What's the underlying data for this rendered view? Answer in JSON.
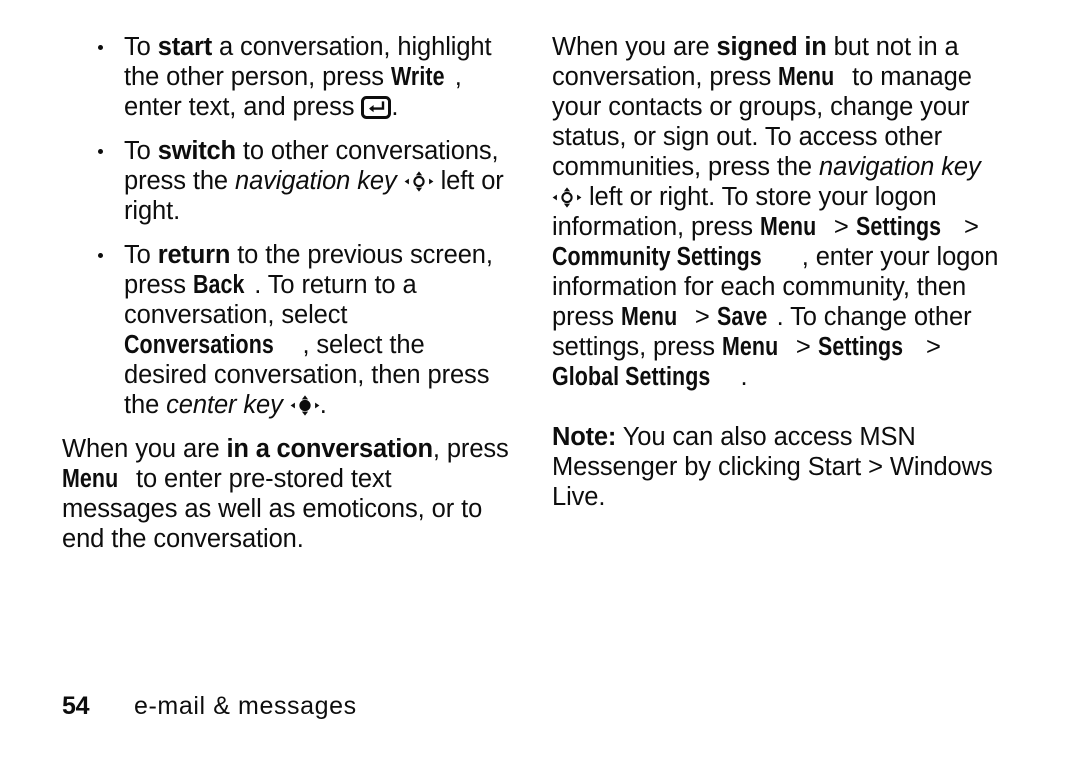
{
  "page": {
    "number": "54",
    "section_title": "e-mail & messages",
    "background_color": "#ffffff",
    "text_color": "#0d0d0d"
  },
  "left_column": {
    "bullets": [
      {
        "id": "start-conversation",
        "segments": [
          {
            "type": "text",
            "value": "To "
          },
          {
            "type": "strong",
            "value": "start"
          },
          {
            "type": "text",
            "value": " a conversation, highlight the other person, press "
          },
          {
            "type": "ui",
            "value": "Write"
          },
          {
            "type": "text",
            "value": ", enter text, and press "
          },
          {
            "type": "icon",
            "value": "enter-key-icon"
          },
          {
            "type": "text",
            "value": "."
          }
        ]
      },
      {
        "id": "switch-conversation",
        "segments": [
          {
            "type": "text",
            "value": "To "
          },
          {
            "type": "strong",
            "value": "switch"
          },
          {
            "type": "text",
            "value": " to other conversations, press the "
          },
          {
            "type": "em",
            "value": "navigation key"
          },
          {
            "type": "text",
            "value": " "
          },
          {
            "type": "icon",
            "value": "navigation-key-icon"
          },
          {
            "type": "text",
            "value": " left or right."
          }
        ]
      },
      {
        "id": "return-previous-screen",
        "segments": [
          {
            "type": "text",
            "value": "To "
          },
          {
            "type": "strong",
            "value": "return"
          },
          {
            "type": "text",
            "value": " to the previous screen, press "
          },
          {
            "type": "ui",
            "value": "Back"
          },
          {
            "type": "text",
            "value": ". To return to a conversation, select "
          },
          {
            "type": "ui",
            "value": "Conversations"
          },
          {
            "type": "text",
            "value": ", select the desired conversation, then press the "
          },
          {
            "type": "em",
            "value": "center key"
          },
          {
            "type": "text",
            "value": " "
          },
          {
            "type": "icon",
            "value": "center-key-icon"
          },
          {
            "type": "text",
            "value": "."
          }
        ]
      }
    ],
    "paragraph": {
      "id": "in-a-conversation",
      "segments": [
        {
          "type": "text",
          "value": "When you are "
        },
        {
          "type": "strong",
          "value": "in a conversation"
        },
        {
          "type": "text",
          "value": ", press "
        },
        {
          "type": "ui",
          "value": "Menu"
        },
        {
          "type": "text",
          "value": " to enter pre-stored text messages as well as emoticons, or to end the conversation."
        }
      ]
    }
  },
  "right_column": {
    "paragraph_signed_in": {
      "id": "signed-in",
      "segments": [
        {
          "type": "text",
          "value": "When you are "
        },
        {
          "type": "strong",
          "value": "signed in"
        },
        {
          "type": "text",
          "value": " but not in a conversation, press "
        },
        {
          "type": "ui",
          "value": "Menu"
        },
        {
          "type": "text",
          "value": " to manage your contacts or groups, change your status, or sign out. To access other communities, press the "
        },
        {
          "type": "em",
          "value": "navigation key"
        },
        {
          "type": "text",
          "value": " "
        },
        {
          "type": "icon",
          "value": "navigation-key-icon"
        },
        {
          "type": "text",
          "value": " left or right. To store your logon information, press "
        },
        {
          "type": "ui",
          "value": "Menu"
        },
        {
          "type": "text",
          "value": " > "
        },
        {
          "type": "ui",
          "value": "Settings"
        },
        {
          "type": "text",
          "value": " > "
        },
        {
          "type": "ui",
          "value": "Community Settings"
        },
        {
          "type": "text",
          "value": ", enter your logon information for each community, then press "
        },
        {
          "type": "ui",
          "value": "Menu"
        },
        {
          "type": "text",
          "value": " > "
        },
        {
          "type": "ui",
          "value": "Save"
        },
        {
          "type": "text",
          "value": ". To change other settings, press "
        },
        {
          "type": "ui",
          "value": "Menu"
        },
        {
          "type": "text",
          "value": " > "
        },
        {
          "type": "ui",
          "value": "Settings"
        },
        {
          "type": "text",
          "value": " > "
        },
        {
          "type": "ui",
          "value": "Global Settings"
        },
        {
          "type": "text",
          "value": "."
        }
      ]
    },
    "note": {
      "id": "msn-messenger-note",
      "label": "Note:",
      "segments": [
        {
          "type": "strong",
          "value": "Note:"
        },
        {
          "type": "text",
          "value": " You can also access MSN Messenger by clicking Start > Windows Live."
        }
      ]
    }
  }
}
